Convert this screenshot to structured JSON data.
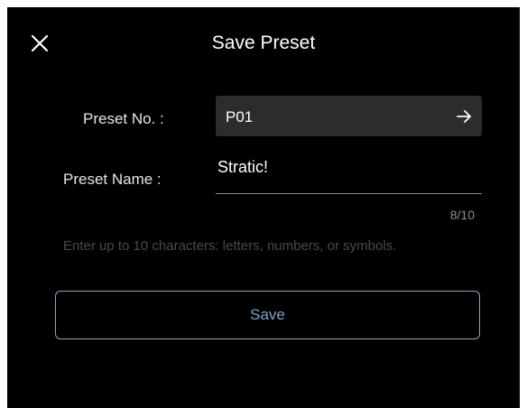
{
  "dialog": {
    "title": "Save Preset",
    "close_icon": "close-icon"
  },
  "preset_no": {
    "label": "Preset No. :",
    "value": "P01",
    "icon": "arrow-right-icon"
  },
  "preset_name": {
    "label": "Preset Name :",
    "value": "Stratic!",
    "counter": "8/10"
  },
  "hint": "Enter up to 10 characters: letters, numbers, or symbols.",
  "save_button": {
    "label": "Save"
  },
  "colors": {
    "background": "#000000",
    "field_background": "#2c2c2e",
    "accent_text": "#7ca3cf",
    "accent_border": "#8fa6c3",
    "hint_text": "#4a4a4d"
  }
}
